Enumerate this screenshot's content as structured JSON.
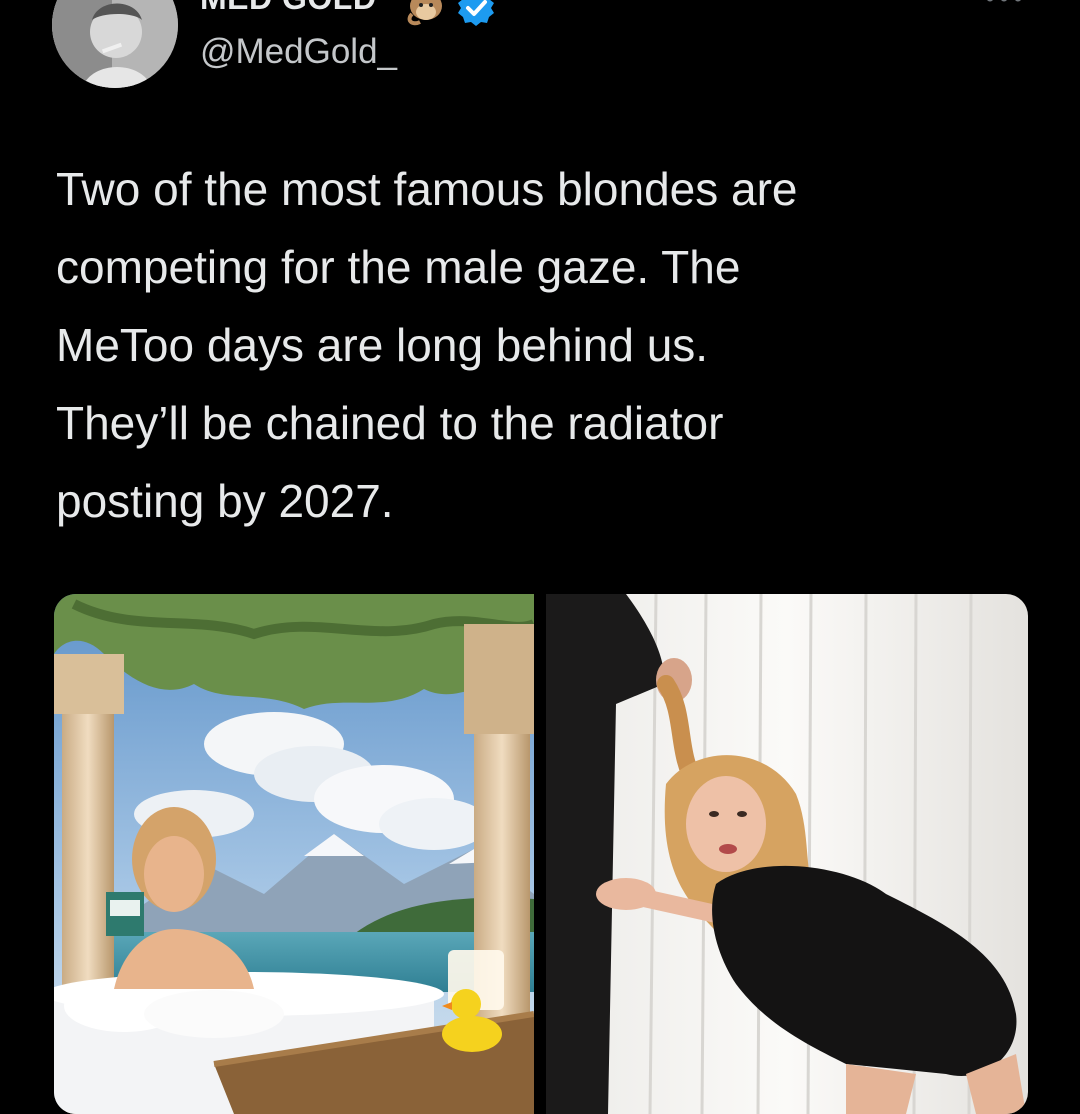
{
  "tweet": {
    "display_name": "MED GOLD",
    "handle": "@MedGold_",
    "text_lines": [
      "Two of the most famous blondes are",
      "competing for the male gaze. The",
      "MeToo days are long behind us.",
      "They’ll be chained to the radiator",
      "posting by 2027."
    ],
    "verified": true,
    "emoji_icon": "monkey-emoji-icon",
    "avatar_icon": "avatar-photo"
  },
  "media": {
    "count": 2,
    "image_1": "bathtub-scene-photo",
    "image_2": "curtain-scene-photo"
  },
  "colors": {
    "background": "#000000",
    "text": "#e7e9ea",
    "handle": "#c4c7ca",
    "verified": "#1d9bf0"
  }
}
